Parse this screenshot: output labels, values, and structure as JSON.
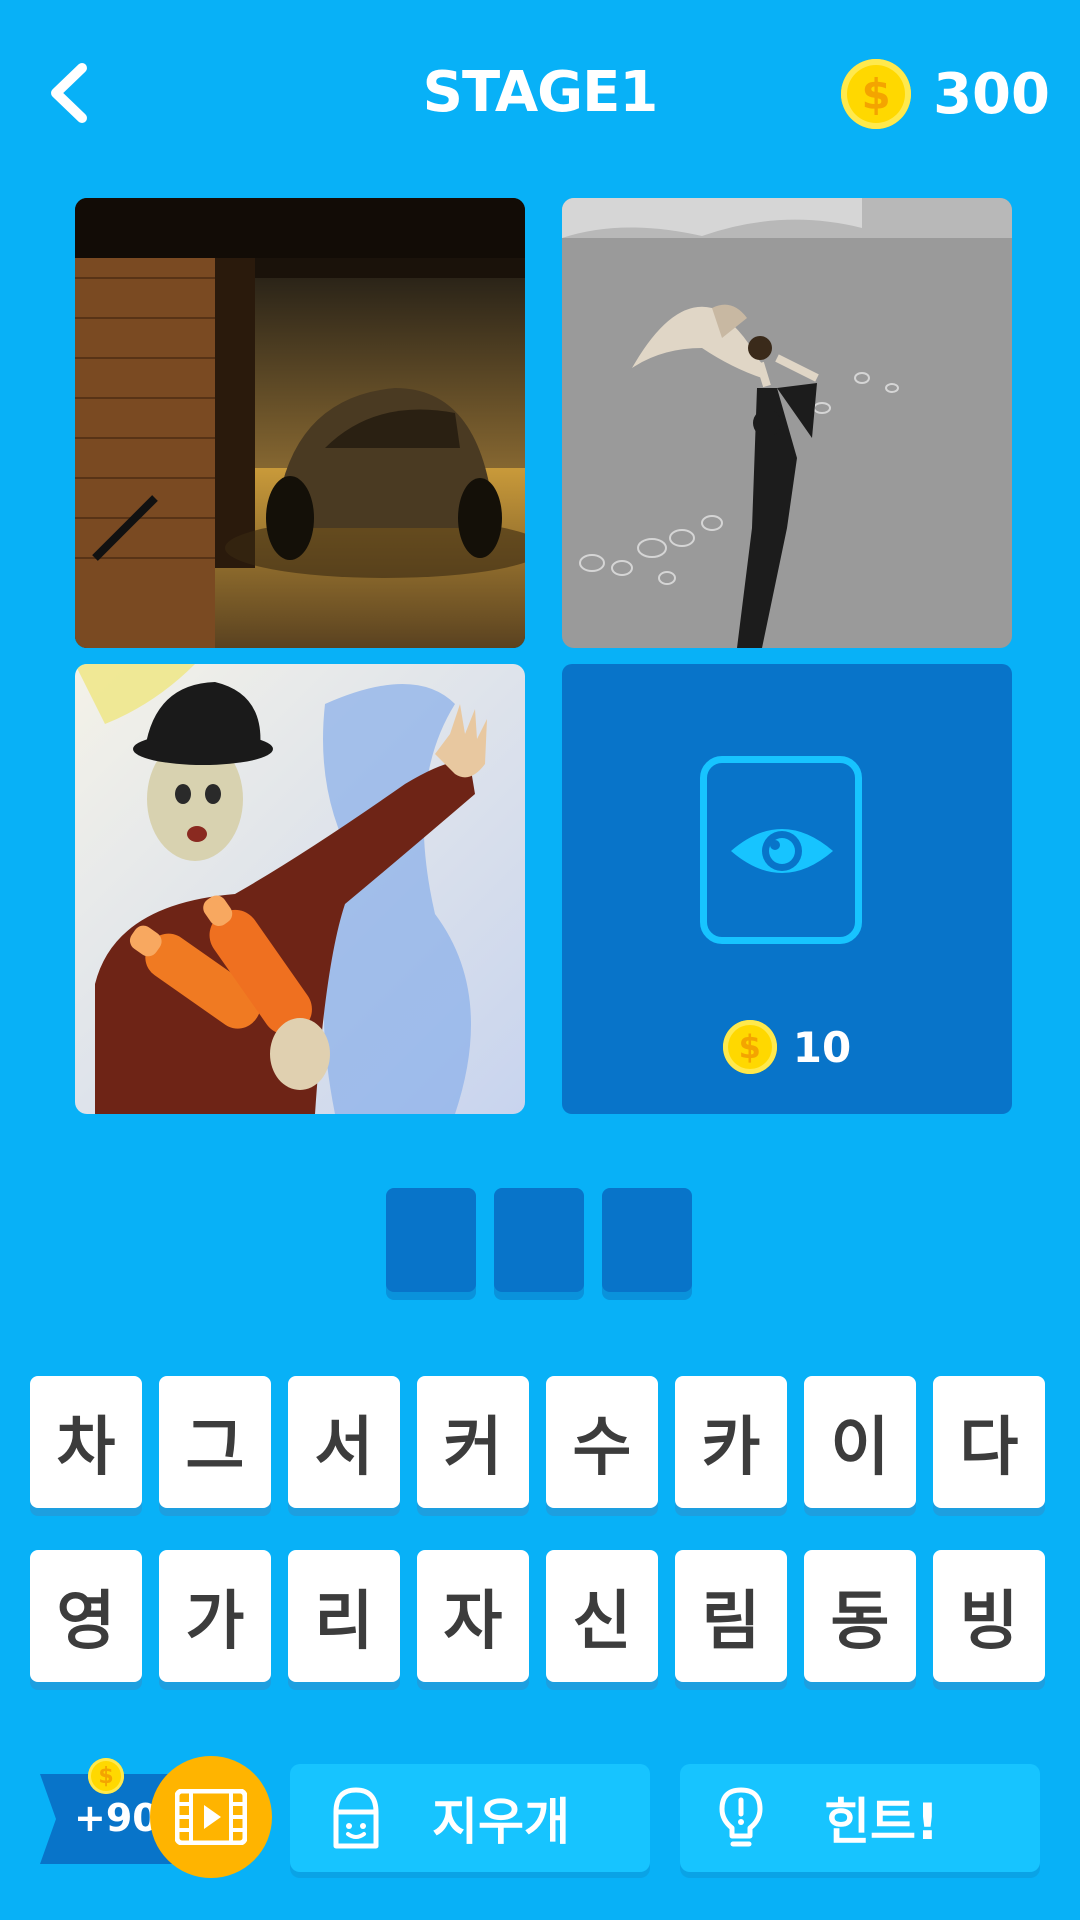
{
  "header": {
    "title": "STAGE1",
    "coin_count": "300",
    "coin_symbol": "$"
  },
  "pictures": [
    {
      "name": "car-in-garage"
    },
    {
      "name": "diver-over-water"
    },
    {
      "name": "mime-juggler"
    }
  ],
  "reveal_tile": {
    "cost": "10",
    "coin_symbol": "$"
  },
  "answer": {
    "slot_count": 3
  },
  "keys": [
    "차",
    "그",
    "서",
    "커",
    "수",
    "카",
    "이",
    "다",
    "영",
    "가",
    "리",
    "자",
    "신",
    "림",
    "동",
    "빙"
  ],
  "bottom": {
    "video_reward": "+90",
    "coin_symbol": "$",
    "eraser_label": "지우개",
    "hint_label": "힌트!"
  },
  "colors": {
    "background": "#08b1f7",
    "tile_dark": "#0874c9",
    "button_light": "#17c4ff",
    "coin": "#ffd800",
    "video_button": "#ffb400"
  }
}
